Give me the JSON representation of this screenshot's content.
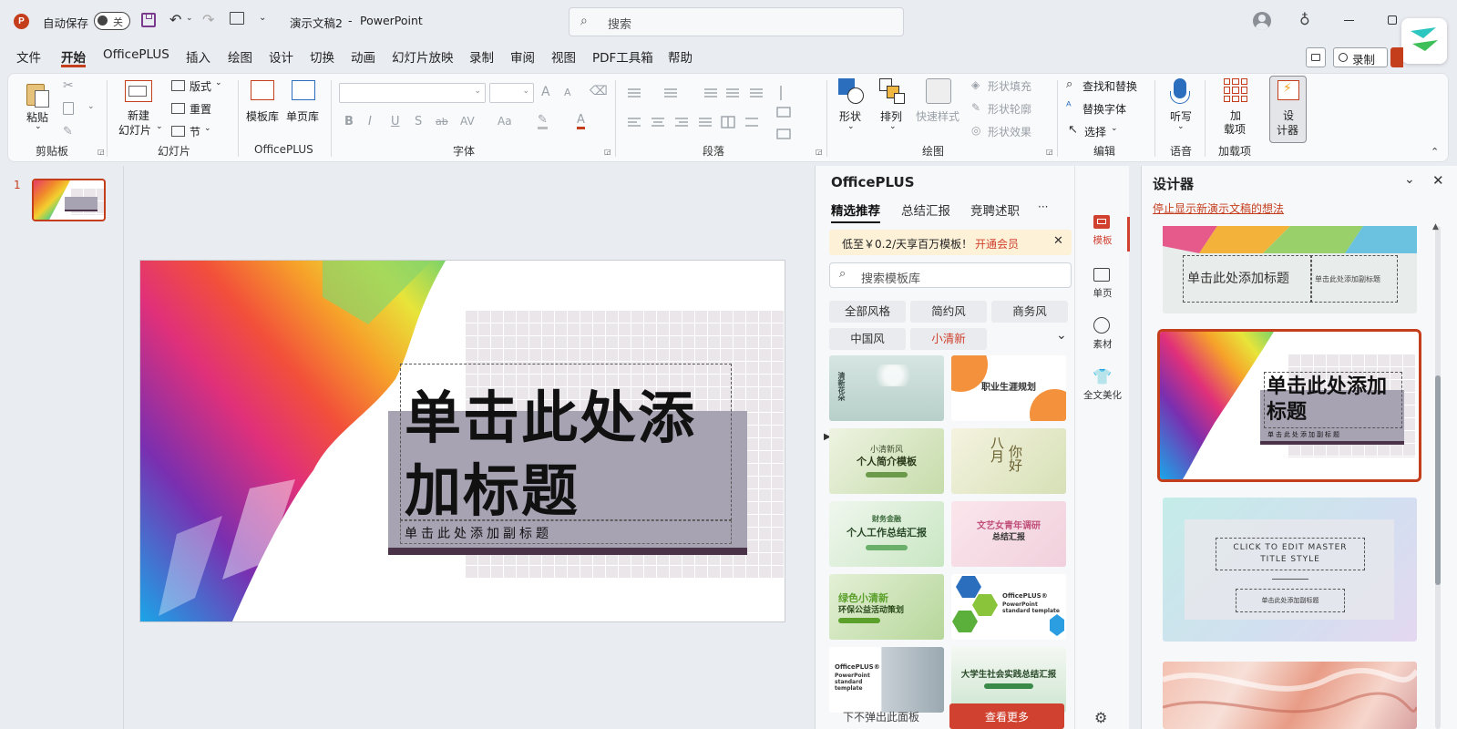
{
  "titlebar": {
    "autosave_label": "自动保存",
    "autosave_state": "关",
    "doc_title": "演示文稿2",
    "dash": "-",
    "app_name": "PowerPoint",
    "search_placeholder": "搜索"
  },
  "menu": [
    "文件",
    "开始",
    "OfficePLUS",
    "插入",
    "绘图",
    "设计",
    "切换",
    "动画",
    "幻灯片放映",
    "录制",
    "审阅",
    "视图",
    "PDF工具箱",
    "帮助"
  ],
  "menu_active": "开始",
  "right_buttons": {
    "record": "录制"
  },
  "ribbon": {
    "clipboard": {
      "paste": "粘贴",
      "group": "剪贴板"
    },
    "slides": {
      "new_slide_1": "新建",
      "new_slide_2": "幻灯片",
      "layout": "版式",
      "reset": "重置",
      "section": "节",
      "group": "幻灯片"
    },
    "officeplus": {
      "template_lib": "模板库",
      "single_page_lib": "单页库",
      "group": "OfficePLUS"
    },
    "font": {
      "group": "字体",
      "bold": "B",
      "italic": "I",
      "underline": "U",
      "shadow": "S",
      "strike": "ab",
      "spacing": "AV",
      "case": "Aa",
      "grow": "A",
      "shrink": "A"
    },
    "paragraph": {
      "group": "段落"
    },
    "drawing": {
      "shapes": "形状",
      "arrange": "排列",
      "quick_styles": "快速样式",
      "shape_fill": "形状填充",
      "shape_outline": "形状轮廓",
      "shape_effects": "形状效果",
      "group": "绘图"
    },
    "editing": {
      "find_replace": "查找和替换",
      "replace_font": "替换字体",
      "select": "选择",
      "group": "编辑"
    },
    "voice": {
      "dictate": "听写",
      "group": "语音"
    },
    "addins": {
      "addins_1": "加",
      "addins_2": "载项",
      "group": "加载项"
    },
    "designer": {
      "designer_1": "设",
      "designer_2": "计器"
    }
  },
  "slide_number": "1",
  "slide": {
    "title_line1": "单击此处添",
    "title_line2": "加标题",
    "subtitle": "单击此处添加副标题"
  },
  "officeplus_panel": {
    "title": "OfficePLUS",
    "tabs": [
      "精选推荐",
      "总结汇报",
      "竞聘述职"
    ],
    "more": "···",
    "promo_text": "低至￥0.2/天享百万模板！",
    "promo_link": "开通会员",
    "search_placeholder": "搜索模板库",
    "styles": [
      "全部风格",
      "简约风",
      "商务风",
      "中国风",
      "小清新"
    ],
    "selected_style": "小清新",
    "templates": [
      {
        "title": "清新花朵"
      },
      {
        "title": "职业生涯规划"
      },
      {
        "title": "小清新风 个人简介模板",
        "line1": "小清新风",
        "line2": "个人简介模板"
      },
      {
        "title": "八月你好",
        "line1": "八月",
        "line2": "你好"
      },
      {
        "title": "个人工作总结汇报",
        "line1": "财务金融",
        "line2": "个人工作总结汇报"
      },
      {
        "title": "文艺女青年调研总结汇报",
        "line1": "文艺女青年调研",
        "line2": "总结汇报"
      },
      {
        "title": "绿色小清新环保公益活动策划",
        "line1": "绿色小清新",
        "line2": "环保公益活动策划"
      },
      {
        "title": "OfficePLUS PowerPoint standard template",
        "line1": "OfficePLUS®",
        "line2": "PowerPoint standard template"
      },
      {
        "title": "OfficePLUS PowerPoint standard template",
        "line1": "OfficePLUS®",
        "line2": "PowerPoint standard template"
      },
      {
        "title": "大学生社会实践总结汇报"
      }
    ],
    "footer_text": "下不弹出此面板",
    "footer_button": "查看更多"
  },
  "rail": [
    {
      "label": "模板",
      "active": true
    },
    {
      "label": "单页"
    },
    {
      "label": "素材"
    },
    {
      "label": "全文美化"
    }
  ],
  "designer_panel": {
    "title": "设计器",
    "stop_link": "停止显示新演示文稿的想法",
    "card1_title": "单击此处添加标题",
    "card1_subtitle": "单击此处添加副标题",
    "card2_title": "单击此处添加标题",
    "card2_subtitle": "单击此处添加副标题",
    "card3_title": "CLICK TO EDIT MASTER TITLE STYLE",
    "card3_subtitle": "单击此处添加副标题"
  },
  "colors": {
    "accent": "#c43e1c",
    "brand_red": "#d0412f",
    "slide_title_box": "#a7a3b3",
    "slide_title_bar": "#4a3348"
  }
}
